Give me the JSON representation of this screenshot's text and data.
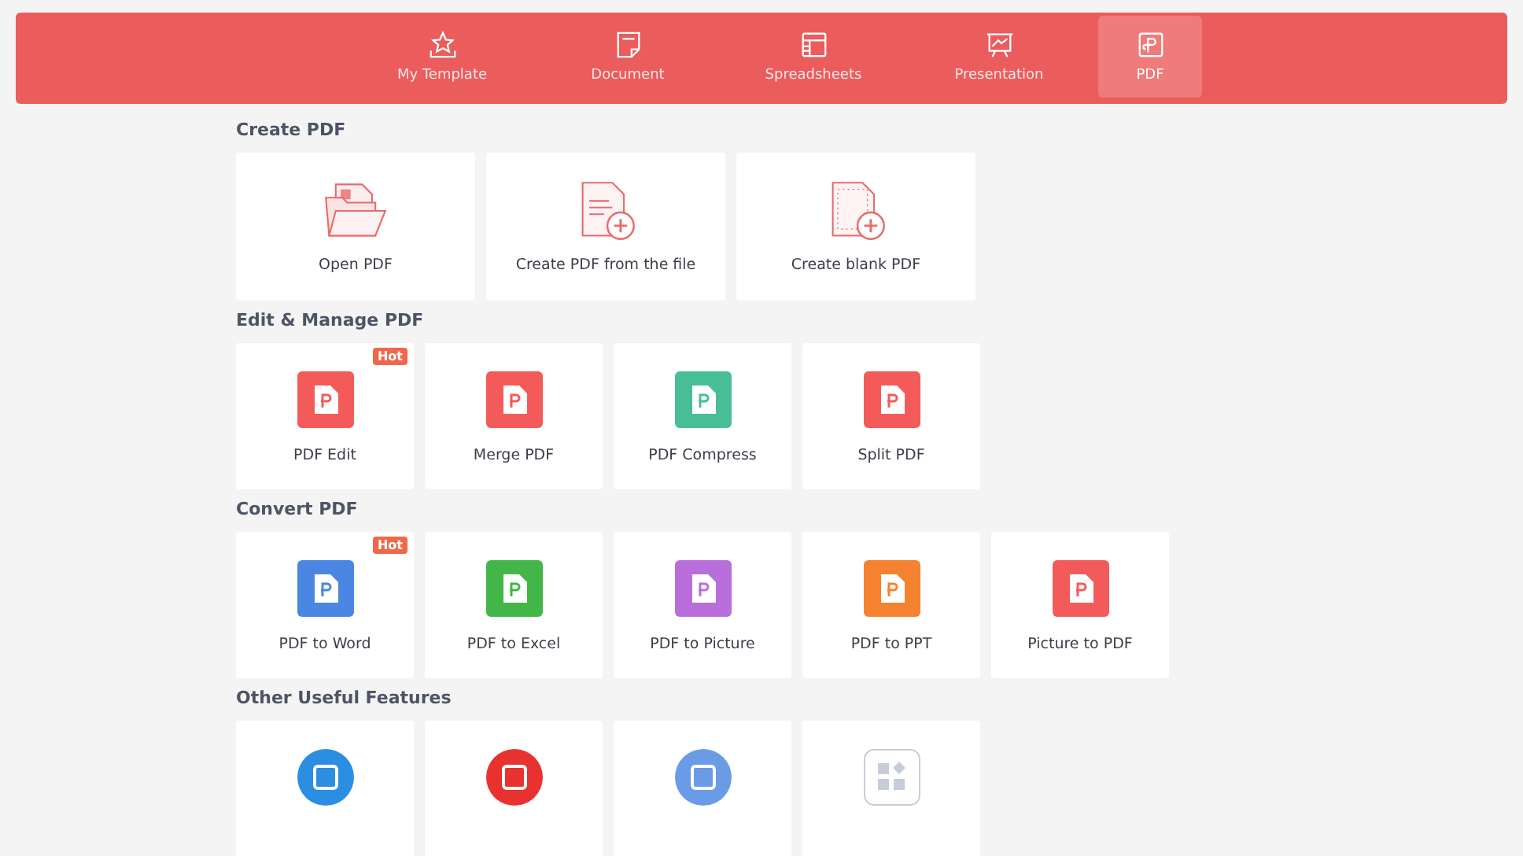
{
  "tabs": [
    {
      "label": "My Template",
      "selected": false
    },
    {
      "label": "Document",
      "selected": false
    },
    {
      "label": "Spreadsheets",
      "selected": false
    },
    {
      "label": "Presentation",
      "selected": false
    },
    {
      "label": "PDF",
      "selected": true
    }
  ],
  "sections": [
    {
      "title": "Create PDF",
      "cards": [
        {
          "label": "Open PDF",
          "kind": "folder",
          "color": "#e96a6a"
        },
        {
          "label": "Create PDF from the file",
          "kind": "new-file",
          "color": "#e96a6a"
        },
        {
          "label": "Create blank PDF",
          "kind": "blank-file",
          "color": "#e96a6a"
        }
      ]
    },
    {
      "title": "Edit & Manage PDF",
      "cards": [
        {
          "label": "PDF Edit",
          "kind": "tile",
          "color": "#f35b5b",
          "badge": "Hot"
        },
        {
          "label": "Merge PDF",
          "kind": "tile",
          "color": "#f35b5b"
        },
        {
          "label": "PDF Compress",
          "kind": "tile",
          "color": "#48be96"
        },
        {
          "label": "Split PDF",
          "kind": "tile",
          "color": "#f35b5b"
        }
      ]
    },
    {
      "title": "Convert PDF",
      "cards": [
        {
          "label": "PDF to Word",
          "kind": "tile",
          "color": "#4a86e2",
          "badge": "Hot"
        },
        {
          "label": "PDF to Excel",
          "kind": "tile",
          "color": "#43b649"
        },
        {
          "label": "PDF to Picture",
          "kind": "tile",
          "color": "#b86fdc"
        },
        {
          "label": "PDF to PPT",
          "kind": "tile",
          "color": "#f4822f"
        },
        {
          "label": "Picture to PDF",
          "kind": "tile",
          "color": "#f35b5b"
        }
      ]
    },
    {
      "title": "Other Useful Features",
      "cards": [
        {
          "kind": "circle",
          "color": "#2b8ee0"
        },
        {
          "kind": "circle",
          "color": "#e8322f"
        },
        {
          "kind": "circle",
          "color": "#6a9be6"
        },
        {
          "kind": "ghost",
          "color": "#c7cdd8"
        }
      ]
    }
  ]
}
